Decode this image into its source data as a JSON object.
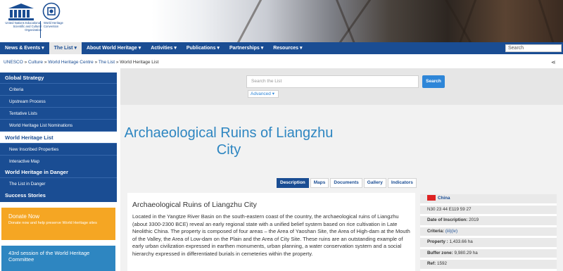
{
  "header": {
    "logo1_text": "United Nations Educational, Scientific and Cultural Organization",
    "logo2_text": "World Heritage Convention"
  },
  "nav": {
    "items": [
      "News & Events",
      "The List",
      "About World Heritage",
      "Activities",
      "Publications",
      "Partnerships",
      "Resources"
    ],
    "search_placeholder": "Search"
  },
  "breadcrumb": {
    "items": [
      "UNESCO",
      "Culture",
      "World Heritage Centre",
      "The List",
      "World Heritage List"
    ]
  },
  "sidebar": {
    "global_strategy": "Global Strategy",
    "global_items": [
      "Criteria",
      "Upstream Process",
      "Tentative Lists",
      "World Heritage List Nominations"
    ],
    "world_heritage_list": "World Heritage List",
    "whl_items": [
      "New Inscribed Properties",
      "Interactive Map"
    ],
    "in_danger": "World Heritage in Danger",
    "danger_items": [
      "The List in Danger"
    ],
    "success": "Success Stories",
    "donate_title": "Donate Now",
    "donate_text": "Donate now and help preserve World Heritage sites",
    "session_text": "43rd session of the World Heritage Committee"
  },
  "search": {
    "placeholder": "Search the List",
    "button": "Search",
    "advanced": "Advanced"
  },
  "site": {
    "title": "Archaeological Ruins of Liangzhu City",
    "tabs": [
      "Description",
      "Maps",
      "Documents",
      "Gallery",
      "Indicators"
    ],
    "heading": "Archaeological Ruins of Liangzhu City",
    "description": "Located in the Yangtze River Basin on the south-eastern coast of the country, the archaeological ruins of Liangzhu (about 3300-2300 BCE) reveal an early regional state with a unified belief system based on rice cultivation in Late Neolithic China. The property is composed of four areas – the Area of Yaoshan Site, the Area of High-dam at the Mouth of the Valley, the Area of Low-dam on the Plain and the Area of City Site. These ruins are an outstanding example of early urban civilization expressed in earthen monuments, urban planning, a water conservation system and a social hierarchy expressed in differentiated burials in cemeteries within the property."
  },
  "info": {
    "country": "China",
    "coords": "N30 23 44 E119 59 27",
    "date_label": "Date of Inscription:",
    "date_value": "2019",
    "criteria_label": "Criteria:",
    "criteria_value": "(iii)(iv)",
    "property_label": "Property :",
    "property_value": "1,433.66 ha",
    "buffer_label": "Buffer zone:",
    "buffer_value": "9,980.29 ha",
    "ref_label": "Ref:",
    "ref_value": "1592"
  },
  "colors": {
    "primary": "#1a4d93",
    "accent": "#2e86c1",
    "donate": "#f5a623"
  }
}
